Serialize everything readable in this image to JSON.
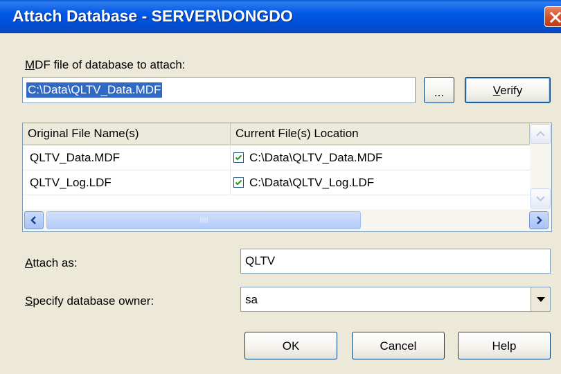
{
  "window": {
    "title": "Attach Database - SERVER\\DONGDO"
  },
  "mdf": {
    "label_underlined": "M",
    "label_rest": "DF file of database to attach:",
    "value": "C:\\Data\\QLTV_Data.MDF",
    "browse_label": "...",
    "verify_underlined": "V",
    "verify_rest": "erify"
  },
  "grid": {
    "headers": [
      "Original File Name(s)",
      "Current File(s) Location"
    ],
    "rows": [
      {
        "name": "QLTV_Data.MDF",
        "location": "C:\\Data\\QLTV_Data.MDF",
        "checked": true
      },
      {
        "name": "QLTV_Log.LDF",
        "location": "C:\\Data\\QLTV_Log.LDF",
        "checked": true
      }
    ]
  },
  "attach_as": {
    "label_underlined": "A",
    "label_rest": "ttach as:",
    "value": "QLTV"
  },
  "owner": {
    "label_underlined": "S",
    "label_rest": "pecify database owner:",
    "value": "sa"
  },
  "buttons": {
    "ok": "OK",
    "cancel": "Cancel",
    "help": "Help"
  },
  "icons": {
    "close": "close-icon",
    "check": "check-icon",
    "scroll_up": "arrow-up-icon",
    "scroll_down": "arrow-down-icon",
    "scroll_left": "arrow-left-icon",
    "scroll_right": "arrow-right-icon",
    "dropdown": "chevron-down-icon",
    "grip": "grip-icon"
  }
}
